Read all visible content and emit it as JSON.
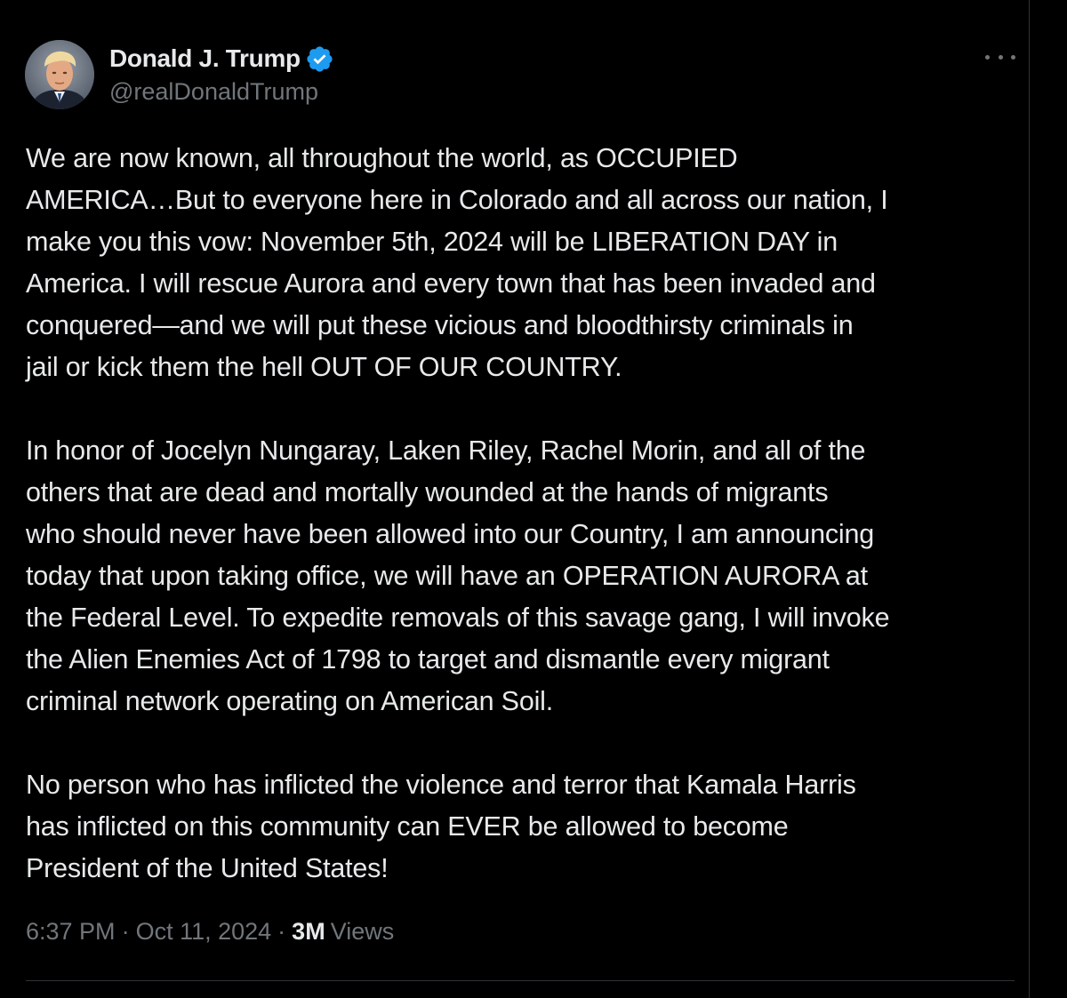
{
  "author": {
    "display_name": "Donald J. Trump",
    "handle": "@realDonaldTrump",
    "verified": true,
    "verified_color": "#1d9bf0",
    "avatar_icon": "profile-photo"
  },
  "more_menu_icon": "ellipsis-icon",
  "tweet": {
    "paragraphs": [
      "We are now known, all throughout the world, as OCCUPIED\nAMERICA…But to everyone here in Colorado and all across our nation, I\nmake you this vow: November 5th, 2024 will be LIBERATION DAY in\nAmerica. I will rescue Aurora and every town that has been invaded and\nconquered—and we will put these vicious and bloodthirsty criminals in\njail or kick them the hell OUT OF OUR COUNTRY.",
      "In honor of Jocelyn Nungaray, Laken Riley, Rachel Morin, and all of the\nothers that are dead and mortally wounded at the hands of migrants\nwho should never have been allowed into our Country, I am announcing\ntoday that upon taking office, we will have an OPERATION AURORA at\nthe Federal Level. To expedite removals of this savage gang, I will invoke\nthe Alien Enemies Act of 1798 to target and dismantle every migrant\ncriminal network operating on American Soil.",
      "No person who has inflicted the violence and terror that Kamala Harris\nhas inflicted on this community can EVER be allowed to become\nPresident of the United States!"
    ]
  },
  "meta": {
    "time": "6:37 PM",
    "separator": "·",
    "date": "Oct 11, 2024",
    "views_count": "3M",
    "views_label": "Views"
  },
  "colors": {
    "background": "#000000",
    "text_primary": "#e7e9ea",
    "text_secondary": "#71767b",
    "border": "#2f3336"
  }
}
